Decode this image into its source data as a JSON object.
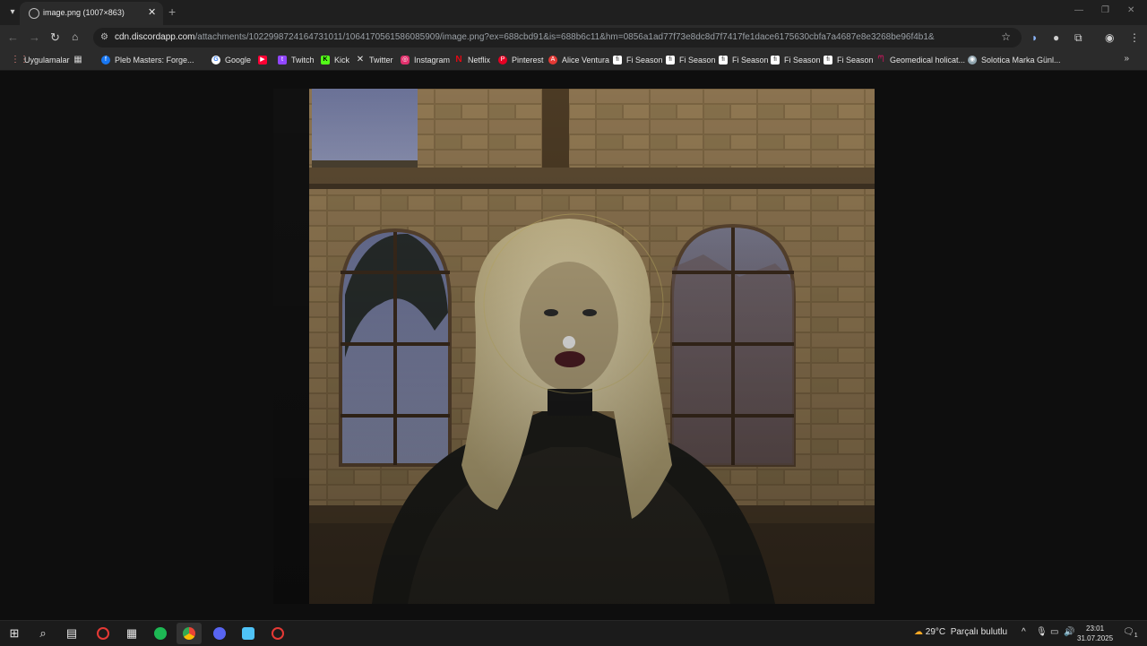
{
  "browser": {
    "tab": {
      "title": "image.png (1007×863)",
      "close_glyph": "✕"
    },
    "new_tab_glyph": "+",
    "window_controls": [
      "—",
      "❐",
      "✕"
    ],
    "address": {
      "host": "cdn.discordapp.com",
      "path": "/attachments/1022998724164731011/1064170561586085909/image.png?ex=688cbd91&is=688b6c11&hm=0856a1ad77f73e8dc8d7f7417fe1dace6175630cbfa7a4687e8e3268be96f4b1&"
    },
    "bookmarks": [
      {
        "label": "Uygulamalar",
        "icon": "apps-grid-icon",
        "color": "#f28b82"
      },
      {
        "label": "",
        "icon": "grid-icon",
        "color": "#cfcfcf"
      },
      {
        "label": "Pleb Masters: Forge...",
        "icon": "facebook-icon",
        "color": "#1877f2"
      },
      {
        "label": "Google",
        "icon": "google-icon",
        "color": "#4285f4"
      },
      {
        "label": "",
        "icon": "youtube-icon",
        "color": "#ff0033"
      },
      {
        "label": "Twitch",
        "icon": "twitch-icon",
        "color": "#9146ff"
      },
      {
        "label": "Kick",
        "icon": "kick-icon",
        "color": "#53fc18"
      },
      {
        "label": "Twitter",
        "icon": "x-icon",
        "color": "#e3e3e3"
      },
      {
        "label": "Instagram",
        "icon": "instagram-icon",
        "color": "#e1306c"
      },
      {
        "label": "Netflix",
        "icon": "netflix-icon",
        "color": "#e50914"
      },
      {
        "label": "Pinterest",
        "icon": "pinterest-icon",
        "color": "#e60023"
      },
      {
        "label": "Alice Ventura",
        "icon": "alice-icon",
        "color": "#e53935"
      },
      {
        "label": "Fi Season",
        "icon": "page-icon",
        "color": "#ffffff"
      },
      {
        "label": "Fi Season",
        "icon": "page-icon",
        "color": "#ffffff"
      },
      {
        "label": "Fi Season",
        "icon": "page-icon",
        "color": "#ffffff"
      },
      {
        "label": "Fi Season",
        "icon": "page-icon",
        "color": "#ffffff"
      },
      {
        "label": "Fi Season",
        "icon": "page-icon",
        "color": "#ffffff"
      },
      {
        "label": "Geomedical holicat...",
        "icon": "geomedical-icon",
        "color": "#c2185b"
      },
      {
        "label": "Solotica Marka Günl...",
        "icon": "solotica-icon",
        "color": "#90a4ae"
      }
    ],
    "bookmarks_more_glyph": "»"
  },
  "taskbar": {
    "weather": {
      "temp": "29°C",
      "desc": "Parçalı bulutlu"
    },
    "clock": {
      "time": "23:01",
      "date": "31.07.2025"
    },
    "notification_count": "1"
  }
}
